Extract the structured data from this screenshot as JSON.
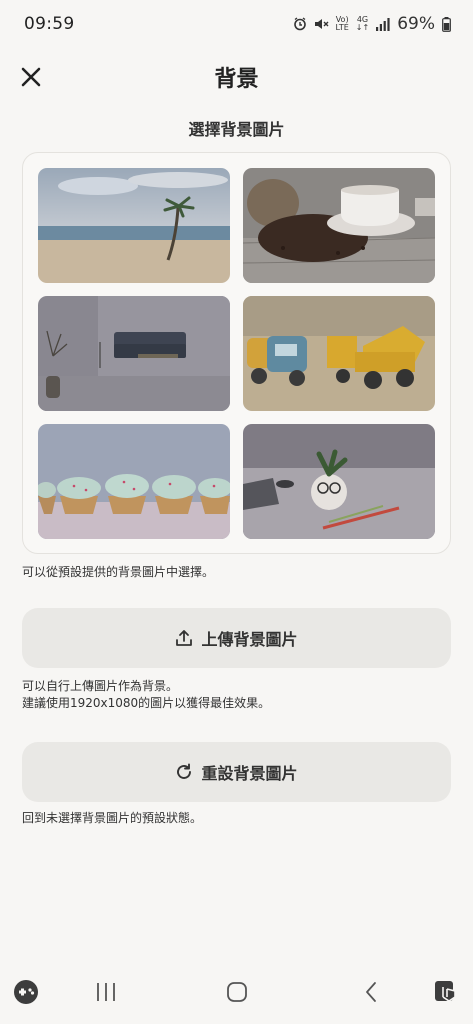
{
  "status": {
    "time": "09:59",
    "network_top": "Vo)",
    "network_bottom": "LTE",
    "gen": "4G",
    "battery": "69%"
  },
  "header": {
    "title": "背景"
  },
  "gallery": {
    "title": "選擇背景圖片",
    "images": [
      {
        "icon": "beach-palm-image"
      },
      {
        "icon": "coffee-beans-image"
      },
      {
        "icon": "living-room-image"
      },
      {
        "icon": "toy-trucks-image"
      },
      {
        "icon": "cupcakes-image"
      },
      {
        "icon": "desk-plant-image"
      }
    ],
    "helper": "可以從預設提供的背景圖片中選擇。"
  },
  "upload": {
    "label": "上傳背景圖片",
    "helper_line1": "可以自行上傳圖片作為背景。",
    "helper_line2": "建議使用1920x1080的圖片以獲得最佳效果。"
  },
  "reset": {
    "label": "重設背景圖片",
    "helper": "回到未選擇背景圖片的預設狀態。"
  }
}
